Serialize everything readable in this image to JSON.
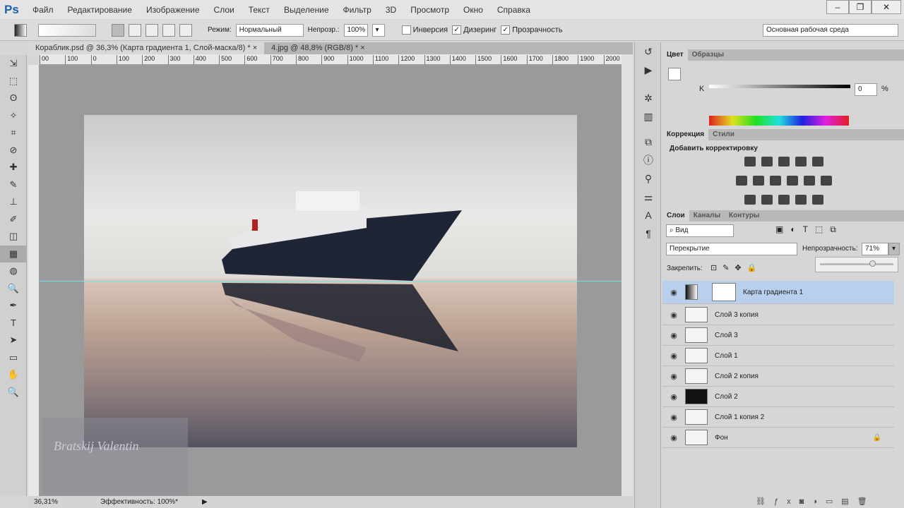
{
  "app": {
    "logo": "Ps",
    "menu": [
      "Файл",
      "Редактирование",
      "Изображение",
      "Слои",
      "Текст",
      "Выделение",
      "Фильтр",
      "3D",
      "Просмотр",
      "Окно",
      "Справка"
    ],
    "window_buttons": [
      "–",
      "❐",
      "✕"
    ]
  },
  "options": {
    "mode_label": "Режим:",
    "mode_value": "Нормальный",
    "opacity_label": "Непрозр.:",
    "opacity_value": "100%",
    "invert_label": "Инверсия",
    "invert_checked": false,
    "dither_label": "Дизеринг",
    "dither_checked": true,
    "transparency_label": "Прозрачность",
    "transparency_checked": true,
    "workspace": "Основная рабочая среда"
  },
  "tabs": [
    {
      "label": "Кораблик.psd @ 36,3% (Карта градиента 1, Слой-маска/8) *",
      "active": true
    },
    {
      "label": "4.jpg @ 48,8% (RGB/8) *",
      "active": false
    }
  ],
  "ruler": [
    "00",
    "100",
    "0",
    "100",
    "200",
    "300",
    "400",
    "500",
    "600",
    "700",
    "800",
    "900",
    "1000",
    "1100",
    "1200",
    "1300",
    "1400",
    "1500",
    "1600",
    "1700",
    "1800",
    "1900",
    "2000"
  ],
  "status": {
    "zoom": "36,31%",
    "info": "Эффективность: 100%*"
  },
  "watermark": "Bratskij Valentin",
  "color_panel": {
    "tabs": [
      "Цвет",
      "Образцы"
    ],
    "channel": "K",
    "value": "0",
    "unit": "%"
  },
  "adjust_panel": {
    "tabs": [
      "Коррекция",
      "Стили"
    ],
    "title": "Добавить корректировку"
  },
  "layers_panel": {
    "tabs": [
      "Слои",
      "Каналы",
      "Контуры"
    ],
    "filter": "Вид",
    "blend": "Перекрытие",
    "opacity_label": "Непрозрачность:",
    "opacity_value": "71%",
    "opacity_slider": 0.71,
    "lock_label": "Закрепить:",
    "layers": [
      {
        "name": "Карта градиента 1",
        "selected": true
      },
      {
        "name": "Слой 3 копия"
      },
      {
        "name": "Слой 3"
      },
      {
        "name": "Слой 1"
      },
      {
        "name": "Слой 2 копия"
      },
      {
        "name": "Слой 2"
      },
      {
        "name": "Слой 1 копия 2"
      },
      {
        "name": "Фон",
        "locked": true
      }
    ]
  },
  "colors": {
    "accent": "#1b5fa8",
    "selection": "#b9cfee",
    "guide": "#6ee6ee"
  }
}
